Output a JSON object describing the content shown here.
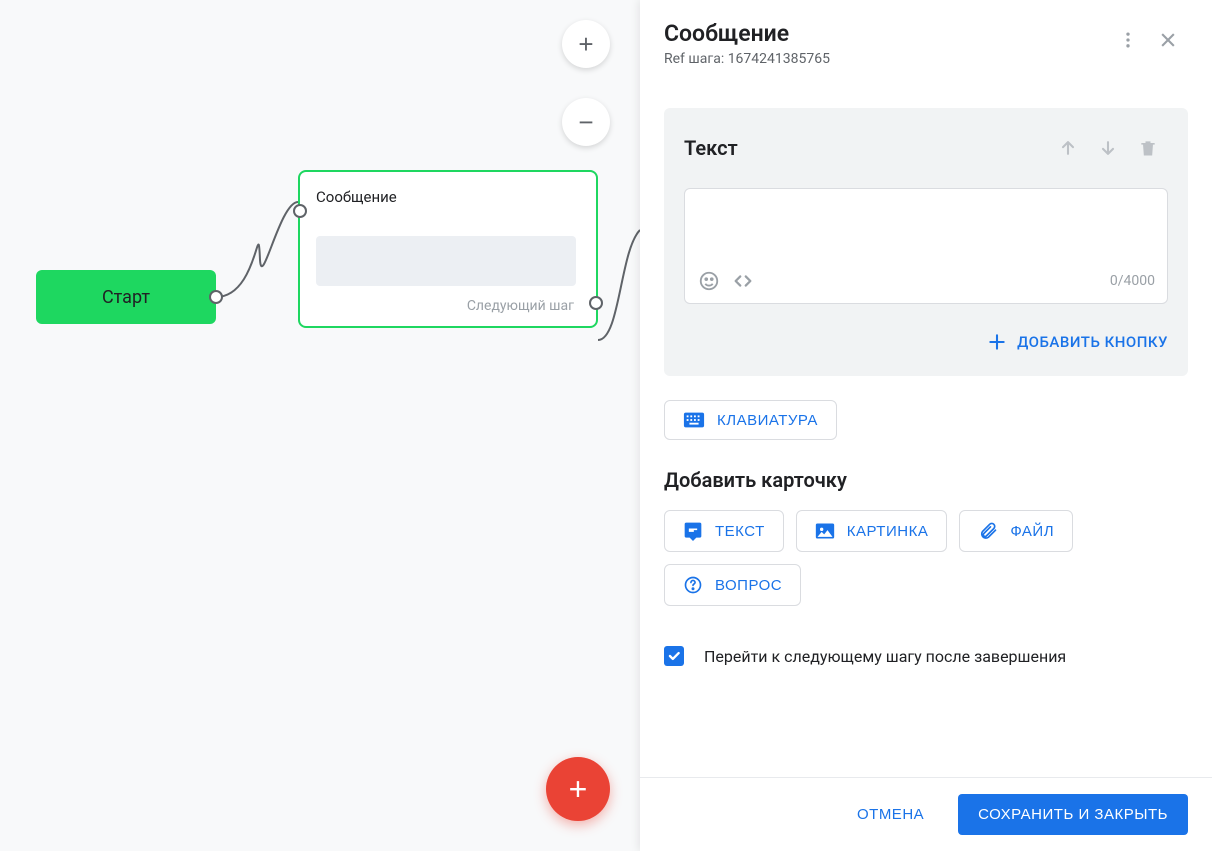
{
  "canvas": {
    "start_label": "Старт",
    "message_node": {
      "title": "Сообщение",
      "next_step": "Следующий шаг"
    }
  },
  "panel": {
    "title": "Сообщение",
    "ref_label": "Ref шага: 1674241385765",
    "text_card": {
      "title": "Текст",
      "counter": "0/4000",
      "add_button": "ДОБАВИТЬ КНОПКУ"
    },
    "keyboard_button": "КЛАВИАТУРА",
    "add_card_title": "Добавить карточку",
    "card_types": {
      "text": "ТЕКСТ",
      "image": "КАРТИНКА",
      "file": "ФАЙЛ",
      "question": "ВОПРОС"
    },
    "checkbox_label": "Перейти к следующему шагу после завершения",
    "cancel": "ОТМЕНА",
    "save": "СОХРАНИТЬ И ЗАКРЫТЬ"
  },
  "colors": {
    "accent_green": "#1ed760",
    "accent_blue": "#1a73e8",
    "fab_red": "#ea4335"
  }
}
